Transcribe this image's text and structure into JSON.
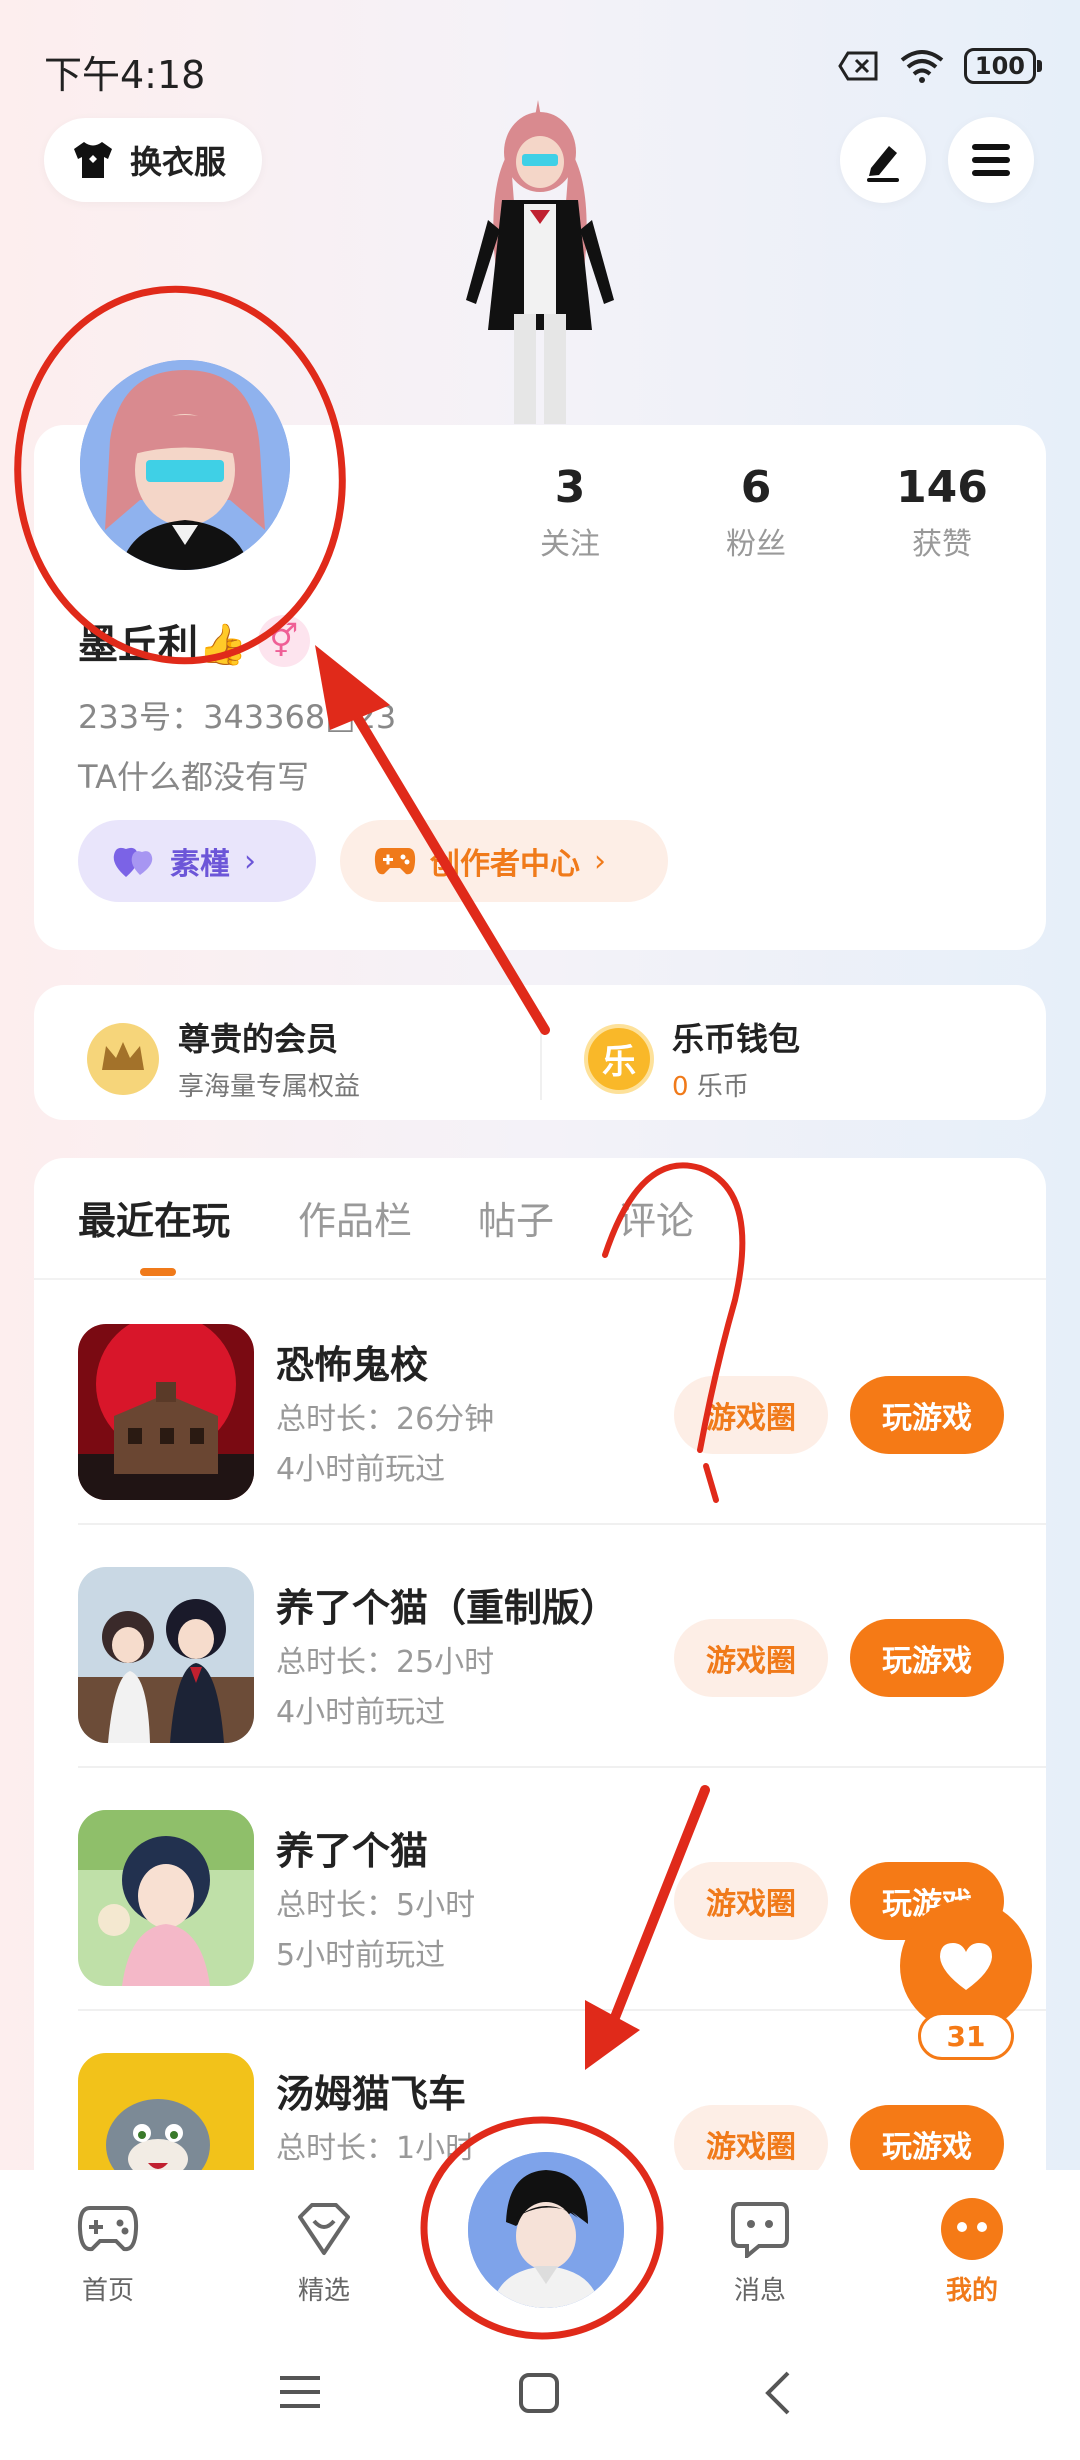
{
  "status_bar": {
    "time": "下午4:18",
    "battery": "100"
  },
  "header": {
    "outfit_label": "换衣服"
  },
  "profile": {
    "stats": [
      {
        "value": "3",
        "label": "关注"
      },
      {
        "value": "6",
        "label": "粉丝"
      },
      {
        "value": "146",
        "label": "获赞"
      }
    ],
    "username": "墨丘利👍",
    "gender_symbol": "⚥",
    "user_id": "233号：343368□23",
    "bio": "TA什么都没有写",
    "tag_label": "素槿",
    "creator_label": "创作者中心"
  },
  "benefits": {
    "member_title": "尊贵的会员",
    "member_sub": "享海量专属权益",
    "member_icon": "crown-icon",
    "wallet_title": "乐币钱包",
    "wallet_icon_text": "乐",
    "wallet_amount": "0",
    "wallet_unit": "乐币"
  },
  "tabs": [
    "最近在玩",
    "作品栏",
    "帖子",
    "评论"
  ],
  "games": [
    {
      "name": "恐怖鬼校",
      "duration": "总时长：26分钟",
      "last_played": "4小时前玩过",
      "circle_label": "游戏圈",
      "play_label": "玩游戏"
    },
    {
      "name": "养了个猫（重制版）",
      "duration": "总时长：25小时",
      "last_played": "4小时前玩过",
      "circle_label": "游戏圈",
      "play_label": "玩游戏"
    },
    {
      "name": "养了个猫",
      "duration": "总时长：5小时",
      "last_played": "5小时前玩过",
      "circle_label": "游戏圈",
      "play_label": "玩游戏"
    },
    {
      "name": "汤姆猫飞车",
      "duration": "总时长：1小时",
      "last_played": "",
      "circle_label": "游戏圈",
      "play_label": "玩游戏"
    }
  ],
  "like_fab": {
    "count": "31"
  },
  "bottom_nav": [
    {
      "label": "首页",
      "icon": "gamepad-icon"
    },
    {
      "label": "精选",
      "icon": "heart-shield-icon"
    },
    {
      "label": "消息",
      "icon": "chat-icon"
    },
    {
      "label": "我的",
      "icon": "me-icon"
    }
  ],
  "colors": {
    "accent": "#f57a16",
    "annotation": "#e02a1a"
  }
}
